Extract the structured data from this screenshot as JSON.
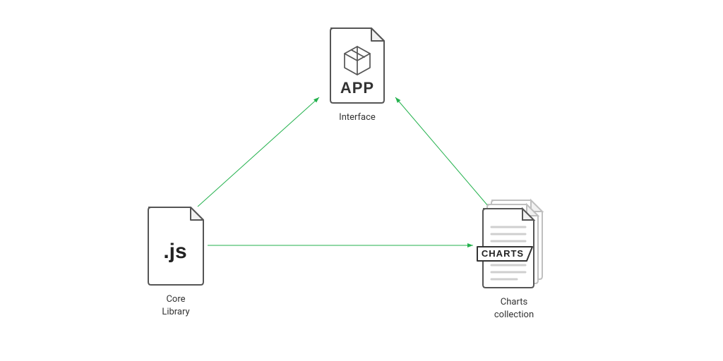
{
  "nodes": {
    "interface": {
      "label": "APP",
      "caption": "Interface"
    },
    "core": {
      "label": ".js",
      "caption": "Core\nLibrary"
    },
    "charts": {
      "label": "CHARTS",
      "caption": "Charts\ncollection"
    }
  },
  "arrows": {
    "color": "#23b14d"
  }
}
